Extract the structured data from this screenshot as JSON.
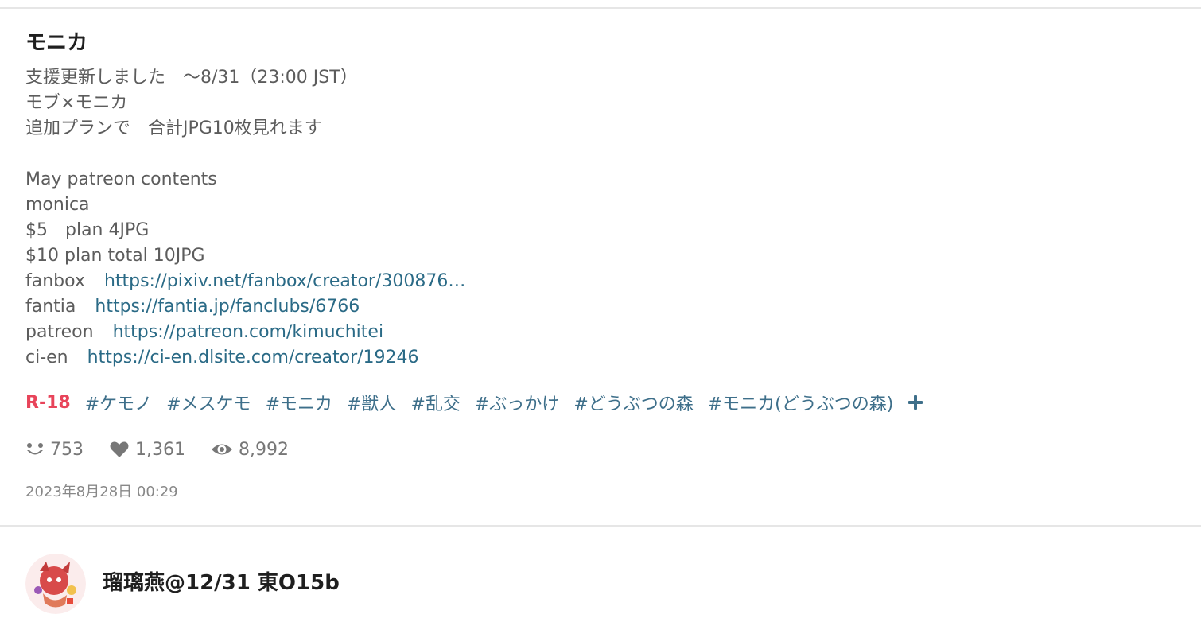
{
  "work": {
    "title": "モニカ",
    "caption": {
      "line1": "支援更新しました　～8/31（23:00 JST）",
      "line2": "モブ×モニカ",
      "line3": "追加プランで　合計JPG10枚見れます",
      "line5": "May patreon contents",
      "line6": "monica",
      "line7": "$5　plan 4JPG",
      "line8": "$10 plan total 10JPG",
      "links": [
        {
          "label": "fanbox",
          "url": "https://pixiv.net/fanbox/creator/300876…"
        },
        {
          "label": "fantia",
          "url": "https://fantia.jp/fanclubs/6766"
        },
        {
          "label": "patreon",
          "url": "https://patreon.com/kimuchitei"
        },
        {
          "label": "ci-en",
          "url": "https://ci-en.dlsite.com/creator/19246"
        }
      ]
    },
    "rating": "R-18",
    "tags": [
      "#ケモノ",
      "#メスケモ",
      "#モニカ",
      "#獣人",
      "#乱交",
      "#ぶっかけ",
      "#どうぶつの森",
      "#モニカ(どうぶつの森)"
    ],
    "stats": {
      "reactions": "753",
      "likes": "1,361",
      "views": "8,992"
    },
    "date": "2023年8月28日 00:29"
  },
  "author": {
    "name": "瑠璃燕@12/31 東O15b"
  },
  "icons": {
    "reactions": "smile-icon",
    "likes": "heart-icon",
    "views": "eye-icon",
    "add_tag": "plus-icon"
  },
  "colors": {
    "rating": "#e8445a",
    "tag": "#3e6f8a",
    "link": "#2a6a86"
  }
}
